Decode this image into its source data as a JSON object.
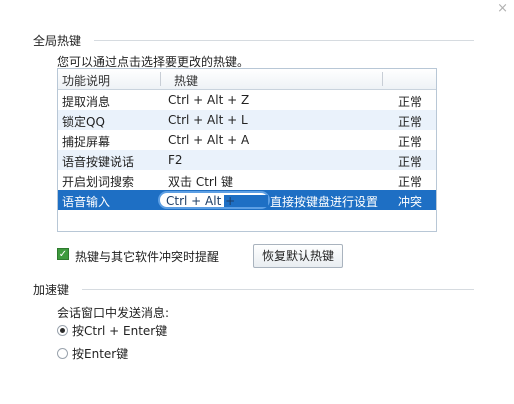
{
  "window": {
    "close_glyph": "×"
  },
  "hotkeys": {
    "section_title": "全局热键",
    "hint": "您可以通过点击选择要更改的热键。",
    "columns": [
      "功能说明",
      "热键"
    ],
    "rows": [
      {
        "function": "提取消息",
        "hotkey": "Ctrl + Alt + Z",
        "status": "正常"
      },
      {
        "function": "锁定QQ",
        "hotkey": "Ctrl + Alt + L",
        "status": "正常"
      },
      {
        "function": "捕捉屏幕",
        "hotkey": "Ctrl + Alt + A",
        "status": "正常"
      },
      {
        "function": "语音按键说话",
        "hotkey": "F2",
        "status": "正常"
      },
      {
        "function": "开启划词搜索",
        "hotkey": "双击 Ctrl 键",
        "status": "正常"
      },
      {
        "function": "语音输入",
        "hotkey": "Ctrl + Alt +",
        "instruction": "直接按键盘进行设置",
        "status": "冲突"
      }
    ],
    "conflict_checkbox": {
      "label": "热键与其它软件冲突时提醒",
      "checked": true
    },
    "restore_button": "恢复默认热键"
  },
  "accel": {
    "section_title": "加速键",
    "subtitle": "会话窗口中发送消息:",
    "options": [
      {
        "label": "按Ctrl + Enter键",
        "selected": true
      },
      {
        "label": "按Enter键",
        "selected": false
      }
    ]
  },
  "colors": {
    "selection": "#1e6fc4",
    "editor_border": "#5d9fe4",
    "checkbox": "#3e9a3e"
  }
}
